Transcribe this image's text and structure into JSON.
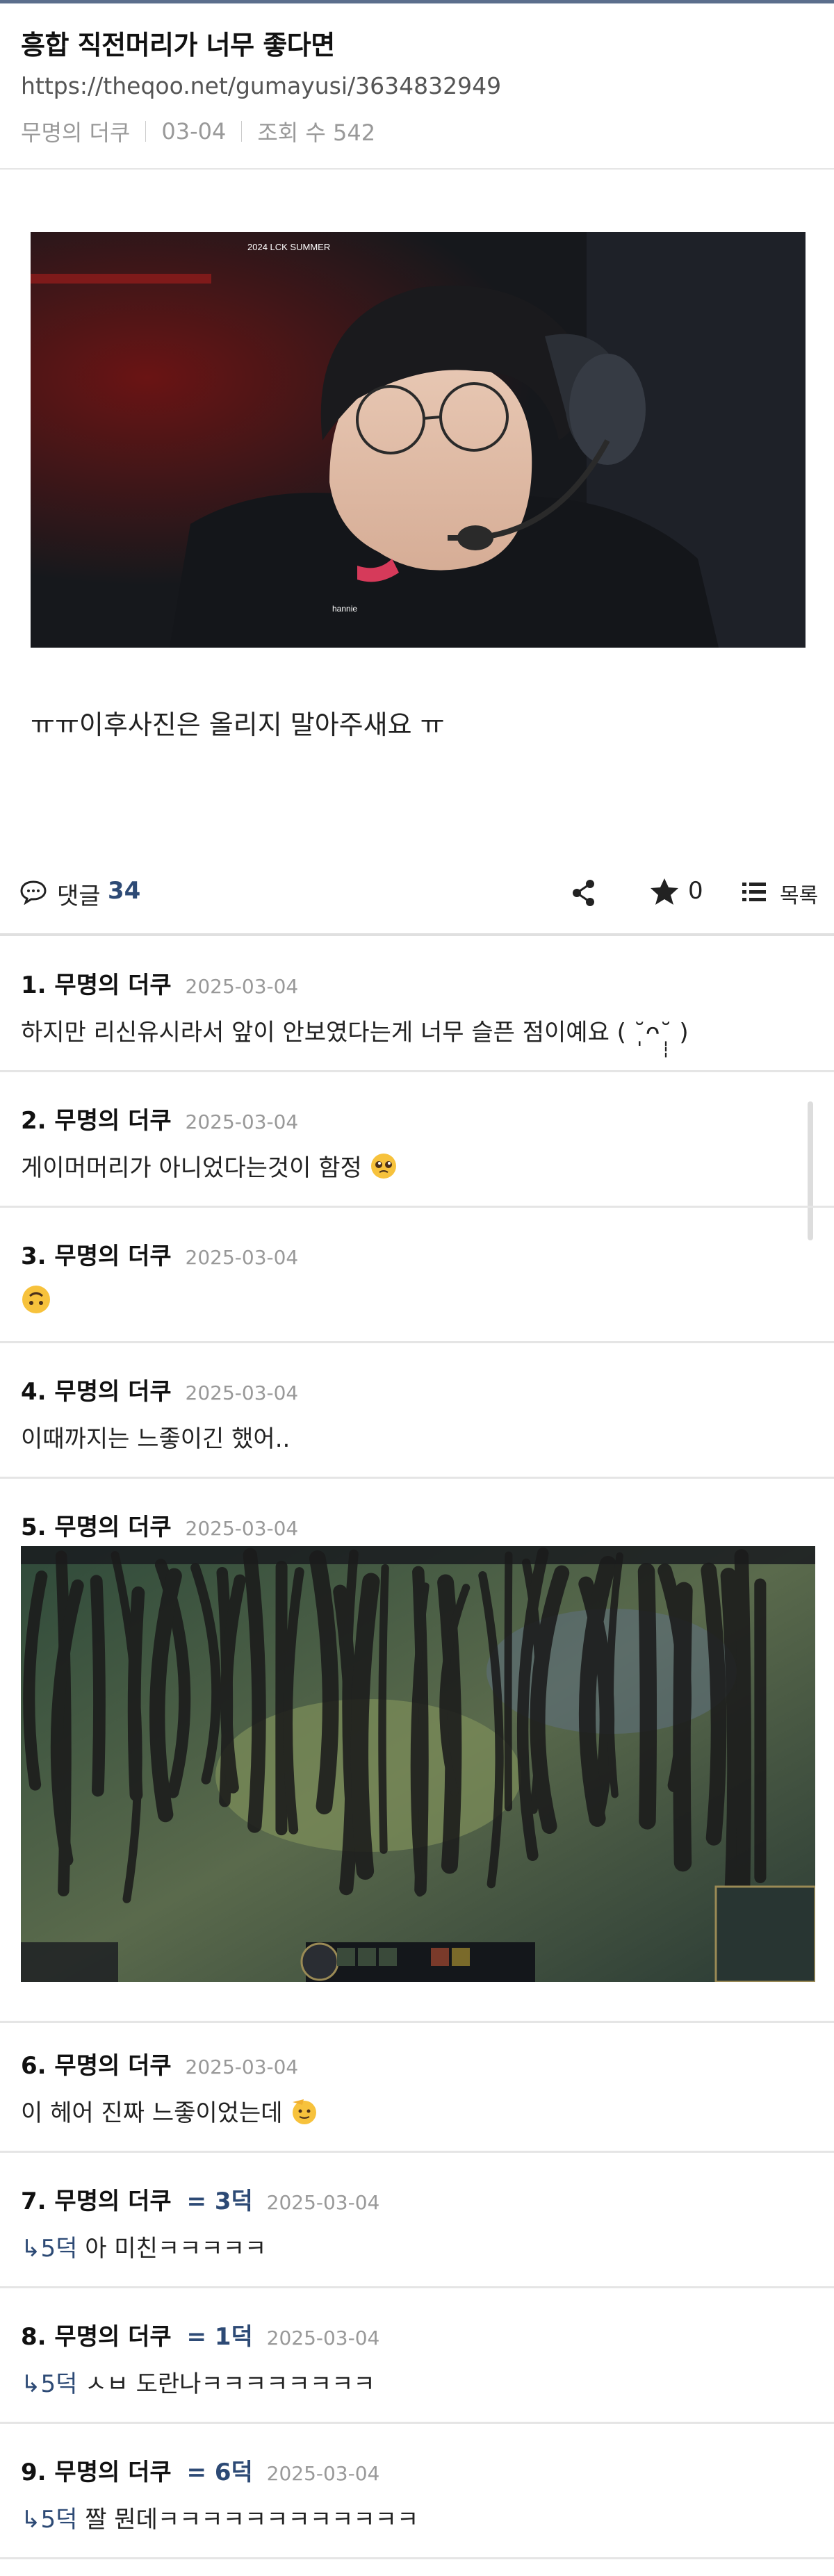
{
  "post": {
    "title": "흥합 직전머리가 너무 좋다면",
    "url": "https://theqoo.net/gumayusi/3634832949",
    "author": "무명의 더쿠",
    "date": "03-04",
    "views_label": "조회 수 542",
    "image_caption_top": "2024 LCK SUMMER",
    "image_caption_name": "hannie",
    "body": "ㅠㅠ이후사진은 올리지 말아주새요 ㅠ"
  },
  "actions": {
    "comment_label": "댓글",
    "comment_count": "34",
    "star_count": "0",
    "list_label": "목록"
  },
  "comments": [
    {
      "num": "1.",
      "author": "무명의 더쿠",
      "date": "2025-03-04",
      "text": "하지만 리신유시라서 앞이 안보였다는게 너무 슬픈 점이예요 ( ˘̩̩̩ᴖ˘̩̩̩ )"
    },
    {
      "num": "2.",
      "author": "무명의 더쿠",
      "date": "2025-03-04",
      "text": "게이머머리가 아니었다는것이 함정",
      "emoji": "pleading-face-emoji"
    },
    {
      "num": "3.",
      "author": "무명의 더쿠",
      "date": "2025-03-04",
      "text": "",
      "emoji": "upside-down-face-emoji"
    },
    {
      "num": "4.",
      "author": "무명의 더쿠",
      "date": "2025-03-04",
      "text": "이때까지는 느좋이긴 했어.."
    },
    {
      "num": "5.",
      "author": "무명의 더쿠",
      "date": "2025-03-04"
    },
    {
      "num": "6.",
      "author": "무명의 더쿠",
      "date": "2025-03-04",
      "text": "이 헤어 진짜 느좋이었는데",
      "emoji": "saluting-face-emoji"
    },
    {
      "num": "7.",
      "author": "무명의 더쿠",
      "deok": "= 3덕",
      "date": "2025-03-04",
      "reply": "↳5덕",
      "text": " 아 미친ㅋㅋㅋㅋㅋ"
    },
    {
      "num": "8.",
      "author": "무명의 더쿠",
      "deok": "= 1덕",
      "date": "2025-03-04",
      "reply": "↳5덕",
      "text": " ㅅㅂ 도란나ㅋㅋㅋㅋㅋㅋㅋㅋ"
    },
    {
      "num": "9.",
      "author": "무명의 더쿠",
      "deok": "= 6덕",
      "date": "2025-03-04",
      "reply": "↳5덕",
      "text": " 짤 뭔데ㅋㅋㅋㅋㅋㅋㅋㅋㅋㅋㅋㅋ"
    }
  ],
  "icons": {
    "comment": "speech-bubble-icon",
    "share": "share-icon",
    "star": "star-icon",
    "list": "list-icon"
  },
  "colors": {
    "accent": "#2d4a75",
    "top_bar": "#5b6e8c",
    "muted": "#999999"
  }
}
